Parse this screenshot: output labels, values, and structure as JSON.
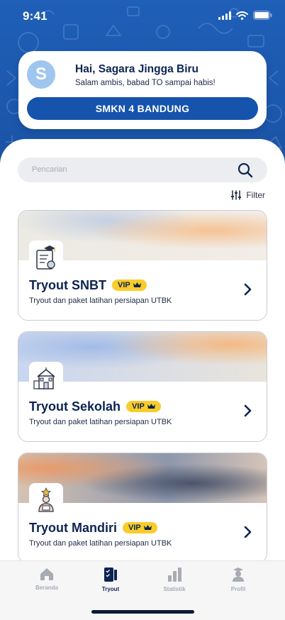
{
  "status_bar": {
    "time": "9:41"
  },
  "profile": {
    "avatar_initial": "S",
    "greeting": "Hai, Sagara Jingga Biru",
    "tagline": "Salam ambis, babad TO sampai habis!",
    "school": "SMKN 4 BANDUNG"
  },
  "search": {
    "placeholder": "Pencarian"
  },
  "filter": {
    "label": "Filter"
  },
  "tryouts": [
    {
      "title": "Tryout SNBT",
      "badge": "VIP",
      "subtitle": "Tryout dan paket latihan persiapan UTBK",
      "icon": "certificate-icon"
    },
    {
      "title": "Tryout Sekolah",
      "badge": "VIP",
      "subtitle": "Tryout dan paket latihan persiapan UTBK",
      "icon": "school-building-icon"
    },
    {
      "title": "Tryout Mandiri",
      "badge": "VIP",
      "subtitle": "Tryout dan paket latihan persiapan UTBK",
      "icon": "student-star-icon"
    }
  ],
  "nav": [
    {
      "label": "Beranda",
      "icon": "home-icon",
      "active": false
    },
    {
      "label": "Tryout",
      "icon": "tryout-icon",
      "active": true
    },
    {
      "label": "Statistik",
      "icon": "chart-icon",
      "active": false
    },
    {
      "label": "Profil",
      "icon": "profile-icon",
      "active": false
    }
  ],
  "colors": {
    "primary": "#1653ad",
    "dark_text": "#0d2452",
    "vip": "#f7cd2b",
    "hero": "#1f5fb8"
  }
}
